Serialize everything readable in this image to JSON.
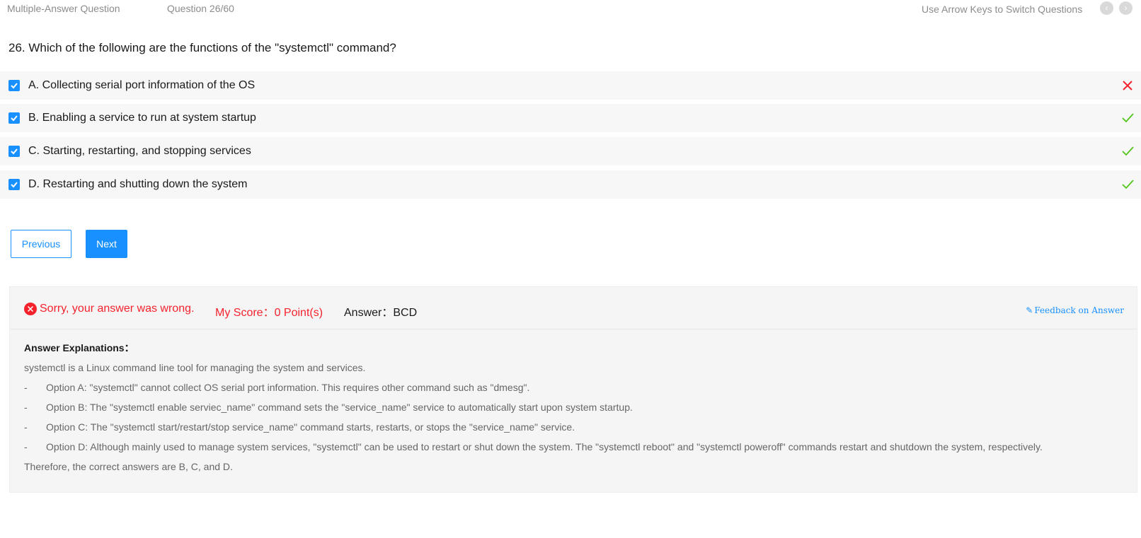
{
  "header": {
    "question_type": "Multiple-Answer Question",
    "progress": "Question 26/60",
    "hint": "Use Arrow Keys to Switch Questions",
    "prev_icon": "chevron-left-icon",
    "next_icon": "chevron-right-icon"
  },
  "question": {
    "title": "26. Which of the following are the functions of the \"systemctl\" command?",
    "options": [
      {
        "label": "A. Collecting serial port information of the OS",
        "checked": true,
        "result": "wrong"
      },
      {
        "label": "B. Enabling a service to run at system startup",
        "checked": true,
        "result": "correct"
      },
      {
        "label": "C. Starting, restarting, and stopping services",
        "checked": true,
        "result": "correct"
      },
      {
        "label": "D. Restarting and shutting down the system",
        "checked": true,
        "result": "correct"
      }
    ]
  },
  "buttons": {
    "previous": "Previous",
    "next": "Next"
  },
  "result": {
    "message": "Sorry, your answer was wrong.",
    "score": "My Score：0 Point(s)",
    "answer": "Answer：BCD",
    "feedback": "Feedback on Answer"
  },
  "explanation": {
    "heading": "Answer Explanations：",
    "intro": "systemctl is a Linux command line tool for managing the system and services.",
    "items": [
      {
        "dash": "-",
        "text": "Option A: \"systemctl\" cannot collect OS serial port information. This requires other command such as \"dmesg\"."
      },
      {
        "dash": "-",
        "text": "Option B: The \"systemctl enable serviec_name\" command sets the \"service_name\" service to automatically start upon system startup."
      },
      {
        "dash": "-",
        "text": "Option C: The \"systemctl start/restart/stop service_name\" command starts, restarts, or stops the \"service_name\" service."
      },
      {
        "dash": "-",
        "text": "Option D: Although mainly used to manage system services, \"systemctl\" can be used to restart or shut down the system. The \"systemctl reboot\" and \"systemctl poweroff\" commands restart and shutdown the system, respectively."
      }
    ],
    "conclusion": "Therefore, the correct answers are B, C, and D."
  },
  "colors": {
    "accent": "#1890ff",
    "error": "#f5222d",
    "success": "#52c41a"
  }
}
